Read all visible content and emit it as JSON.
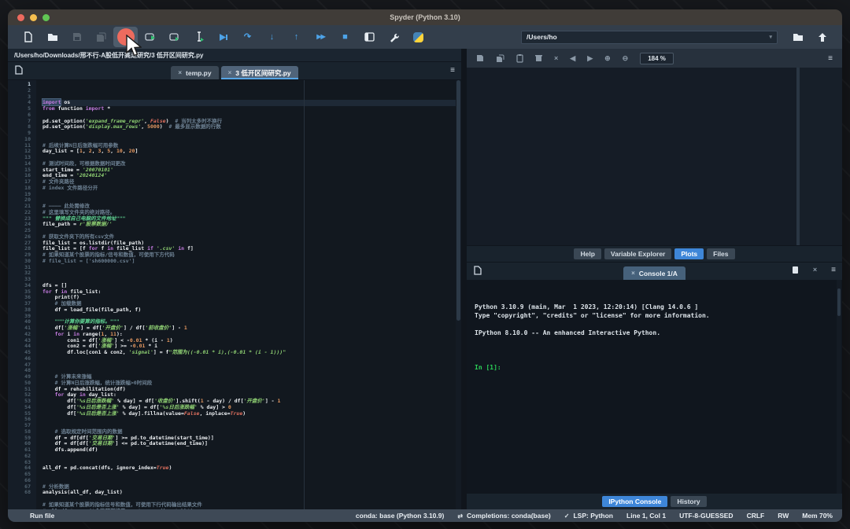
{
  "window": {
    "title": "Spyder (Python 3.10)"
  },
  "toolbar": {
    "path_combo": "/Users/ho",
    "icon_names": [
      "new-file",
      "open-folder",
      "save",
      "save-all",
      "run-file",
      "run-cell",
      "run-cell-advance",
      "run-selection",
      "debug-file",
      "run-to-line",
      "step-into",
      "step-out",
      "continue-execution",
      "stop",
      "maximize-pane",
      "preferences",
      "python-path-manager",
      "working-directory-combo",
      "open-directory",
      "parent-directory"
    ]
  },
  "glyphs": {
    "hamburger": "≡",
    "close": "×",
    "prev": "◀",
    "next": "▶",
    "up_arrow": "↑",
    "down_arrow": "↓",
    "double_play": "▶▶",
    "stop": "■",
    "curved_arrow": "↷",
    "check": "✓",
    "completions": "⇄",
    "dropdown": "▾",
    "zoom_in": "⊕",
    "zoom_out": "⊖",
    "play": "▶",
    "ibeam": "I"
  },
  "breadcrumb": {
    "path": "/Users/ho/Downloads/邢不行-A股低开高走研究/3 低开区间研究.py"
  },
  "editor": {
    "tabs": [
      {
        "label": "temp.py",
        "active": false
      },
      {
        "label": "3 低开区间研究.py",
        "active": true
      }
    ],
    "lines": [
      [
        [
          "k hl",
          "import"
        ],
        [
          "t",
          " os"
        ]
      ],
      [
        [
          "k",
          "from"
        ],
        [
          "t",
          " function "
        ],
        [
          "k",
          "import"
        ],
        [
          "t",
          " *"
        ]
      ],
      [],
      [
        [
          "t",
          "pd.set_option("
        ],
        [
          "s",
          "'expand_frame_repr'"
        ],
        [
          "t",
          ", "
        ],
        [
          "b",
          "False"
        ],
        [
          "t",
          ")  "
        ],
        [
          "c",
          "# 当列太多时不换行"
        ]
      ],
      [
        [
          "t",
          "pd.set_option("
        ],
        [
          "s",
          "'display.max_rows'"
        ],
        [
          "t",
          ", "
        ],
        [
          "n",
          "5000"
        ],
        [
          "t",
          ")  "
        ],
        [
          "c",
          "# 最多显示数据的行数"
        ]
      ],
      [],
      [],
      [
        [
          "c",
          "# 后续计算N日后涨跌幅可用参数"
        ]
      ],
      [
        [
          "t",
          "day_list = ["
        ],
        [
          "n",
          "1"
        ],
        [
          "t",
          ", "
        ],
        [
          "n",
          "2"
        ],
        [
          "t",
          ", "
        ],
        [
          "n",
          "3"
        ],
        [
          "t",
          ", "
        ],
        [
          "n",
          "5"
        ],
        [
          "t",
          ", "
        ],
        [
          "n",
          "10"
        ],
        [
          "t",
          ", "
        ],
        [
          "n",
          "20"
        ],
        [
          "t",
          "]"
        ]
      ],
      [],
      [
        [
          "c",
          "# 测试时间段，可根据数据时间更改"
        ]
      ],
      [
        [
          "t",
          "start_time = "
        ],
        [
          "s",
          "'20070101'"
        ]
      ],
      [
        [
          "t",
          "end_time = "
        ],
        [
          "s",
          "'20240124'"
        ]
      ],
      [
        [
          "c",
          "# 文件夹路径"
        ]
      ],
      [
        [
          "c",
          "# index 文件路径分开"
        ]
      ],
      [],
      [],
      [
        [
          "c",
          "# ———— 此处需修改"
        ]
      ],
      [
        [
          "c",
          "# 这里填写文件夹的绝对路径。"
        ]
      ],
      [
        [
          "d",
          "\"\"\" 替换成自己电脑的文件地址\"\"\""
        ]
      ],
      [
        [
          "t",
          "file_path = "
        ],
        [
          "s",
          "r'股票数据/'"
        ]
      ],
      [],
      [
        [
          "c",
          "# 获取文件夹下的所有csv文件"
        ]
      ],
      [
        [
          "t",
          "file_list = os.listdir(file_path)"
        ]
      ],
      [
        [
          "t",
          "file_list = [f "
        ],
        [
          "k",
          "for"
        ],
        [
          "t",
          " f "
        ],
        [
          "k",
          "in"
        ],
        [
          "t",
          " file_list "
        ],
        [
          "k",
          "if"
        ],
        [
          "t",
          " "
        ],
        [
          "s",
          "'.csv'"
        ],
        [
          "t",
          " "
        ],
        [
          "k",
          "in"
        ],
        [
          "t",
          " f]"
        ]
      ],
      [
        [
          "c",
          "# 如果知道某个股票的指标/信号和数值，可使用下方代码"
        ]
      ],
      [
        [
          "c",
          "# file_list = ['sh600000.csv']"
        ]
      ],
      [],
      [],
      [],
      [
        [
          "t",
          "dfs = []"
        ]
      ],
      [
        [
          "k",
          "for"
        ],
        [
          "t",
          " f "
        ],
        [
          "k",
          "in"
        ],
        [
          "t",
          " file_list:"
        ]
      ],
      [
        [
          "t",
          "    print(f)"
        ]
      ],
      [
        [
          "c",
          "    # 加载数据"
        ]
      ],
      [
        [
          "t",
          "    df = load_file(file_path, f)"
        ]
      ],
      [],
      [
        [
          "d",
          "    \"\"\"计算你要算的指标。\"\"\""
        ]
      ],
      [
        [
          "t",
          "    df["
        ],
        [
          "s",
          "'涨幅'"
        ],
        [
          "t",
          "] = df["
        ],
        [
          "s",
          "'开盘价'"
        ],
        [
          "t",
          "] / df["
        ],
        [
          "s",
          "'前收盘价'"
        ],
        [
          "t",
          "] - "
        ],
        [
          "n",
          "1"
        ]
      ],
      [
        [
          "t",
          "    "
        ],
        [
          "k",
          "for"
        ],
        [
          "t",
          " i "
        ],
        [
          "k",
          "in"
        ],
        [
          "t",
          " range("
        ],
        [
          "n",
          "1"
        ],
        [
          "t",
          ", "
        ],
        [
          "n",
          "11"
        ],
        [
          "t",
          "):"
        ]
      ],
      [
        [
          "t",
          "        con1 = df["
        ],
        [
          "s",
          "'涨幅'"
        ],
        [
          "t",
          "] < -"
        ],
        [
          "n",
          "0.01"
        ],
        [
          "t",
          " * (i - "
        ],
        [
          "n",
          "1"
        ],
        [
          "t",
          ")"
        ]
      ],
      [
        [
          "t",
          "        con2 = df["
        ],
        [
          "s",
          "'涨幅'"
        ],
        [
          "t",
          "] >= -"
        ],
        [
          "n",
          "0.01"
        ],
        [
          "t",
          " * i"
        ]
      ],
      [
        [
          "t",
          "        df.loc[con1 & con2, "
        ],
        [
          "s",
          "'signal'"
        ],
        [
          "t",
          "] = f"
        ],
        [
          "s",
          "\"范围为((-0.01 * i),(-0.01 * (i - 1)))\""
        ]
      ],
      [],
      [],
      [],
      [
        [
          "c",
          "    # 计算未来涨幅"
        ]
      ],
      [
        [
          "c",
          "    # 计算N日后涨跌幅，统计涨跌幅>0时间段"
        ]
      ],
      [
        [
          "t",
          "    df = rehabilitation(df)"
        ]
      ],
      [
        [
          "t",
          "    "
        ],
        [
          "k",
          "for"
        ],
        [
          "t",
          " day "
        ],
        [
          "k",
          "in"
        ],
        [
          "t",
          " day_list:"
        ]
      ],
      [
        [
          "t",
          "        df["
        ],
        [
          "s",
          "'%s日后涨跌幅'"
        ],
        [
          "t",
          " % day] = df["
        ],
        [
          "s",
          "'收盘价'"
        ],
        [
          "t",
          "].shift("
        ],
        [
          "n",
          "1"
        ],
        [
          "t",
          " - day) / df["
        ],
        [
          "s",
          "'开盘价'"
        ],
        [
          "t",
          "] - "
        ],
        [
          "n",
          "1"
        ]
      ],
      [
        [
          "t",
          "        df["
        ],
        [
          "s",
          "'%s日后是否上涨'"
        ],
        [
          "t",
          " % day] = df["
        ],
        [
          "s",
          "'%s日后涨跌幅'"
        ],
        [
          "t",
          " % day] > "
        ],
        [
          "n",
          "0"
        ]
      ],
      [
        [
          "t",
          "        df["
        ],
        [
          "s",
          "'%s日后是否上涨'"
        ],
        [
          "t",
          " % day].fillna(value="
        ],
        [
          "b",
          "False"
        ],
        [
          "t",
          ", inplace="
        ],
        [
          "b",
          "True"
        ],
        [
          "t",
          ")"
        ]
      ],
      [],
      [],
      [
        [
          "c",
          "    # 选取规定时间范围内的数据"
        ]
      ],
      [
        [
          "t",
          "    df = df[df["
        ],
        [
          "s",
          "'交易日期'"
        ],
        [
          "t",
          "] >= pd.to_datetime(start_time)]"
        ]
      ],
      [
        [
          "t",
          "    df = df[df["
        ],
        [
          "s",
          "'交易日期'"
        ],
        [
          "t",
          "] <= pd.to_datetime(end_time)]"
        ]
      ],
      [
        [
          "t",
          "    dfs.append(df)"
        ]
      ],
      [],
      [],
      [
        [
          "t",
          "all_df = pd.concat(dfs, ignore_index="
        ],
        [
          "b",
          "True"
        ],
        [
          "t",
          ")"
        ]
      ],
      [],
      [],
      [
        [
          "c",
          "# 分析数据"
        ]
      ],
      [
        [
          "t",
          "analysis(all_df, day_list)"
        ]
      ],
      [],
      [
        [
          "c",
          "# 如果知道某个股票的指标信号和数值，可使用下行代码输出结果文件"
        ]
      ],
      [
        [
          "c",
          "# all_df.to_csv('个股预测结果.csv', encoding='gbk')"
        ]
      ]
    ]
  },
  "plots": {
    "zoom_level": "184 %",
    "toolbar_icon_names": [
      "save-plot",
      "save-all-plots",
      "copy-plot",
      "remove-plot",
      "remove-all-plots",
      "previous-plot",
      "next-plot",
      "zoom-in",
      "zoom-out",
      "plots-options-menu"
    ],
    "tabs": [
      {
        "label": "Help",
        "active": false
      },
      {
        "label": "Variable Explorer",
        "active": false
      },
      {
        "label": "Plots",
        "active": true
      },
      {
        "label": "Files",
        "active": false
      }
    ]
  },
  "console": {
    "tab_label": "Console 1/A",
    "lines": [
      "Python 3.10.9 (main, Mar  1 2023, 12:20:14) [Clang 14.0.6 ]",
      "Type \"copyright\", \"credits\" or \"license\" for more information.",
      "",
      "IPython 8.10.0 -- An enhanced Interactive Python.",
      ""
    ],
    "prompt": "In [1]:",
    "bottom_tabs": [
      {
        "label": "IPython Console",
        "active": true
      },
      {
        "label": "History",
        "active": false
      }
    ]
  },
  "statusbar": {
    "left": "Run file",
    "items": [
      {
        "label": "conda: base (Python 3.10.9)"
      },
      {
        "icon": "completions-icon",
        "glyph": "⇄",
        "label": "Completions: conda(base)"
      },
      {
        "icon": "check-icon",
        "glyph": "✓",
        "label": "LSP: Python"
      },
      {
        "label": "Line 1, Col 1"
      },
      {
        "label": "UTF-8-GUESSED"
      },
      {
        "label": "CRLF"
      },
      {
        "label": "RW"
      },
      {
        "label": "Mem 70%"
      }
    ]
  }
}
